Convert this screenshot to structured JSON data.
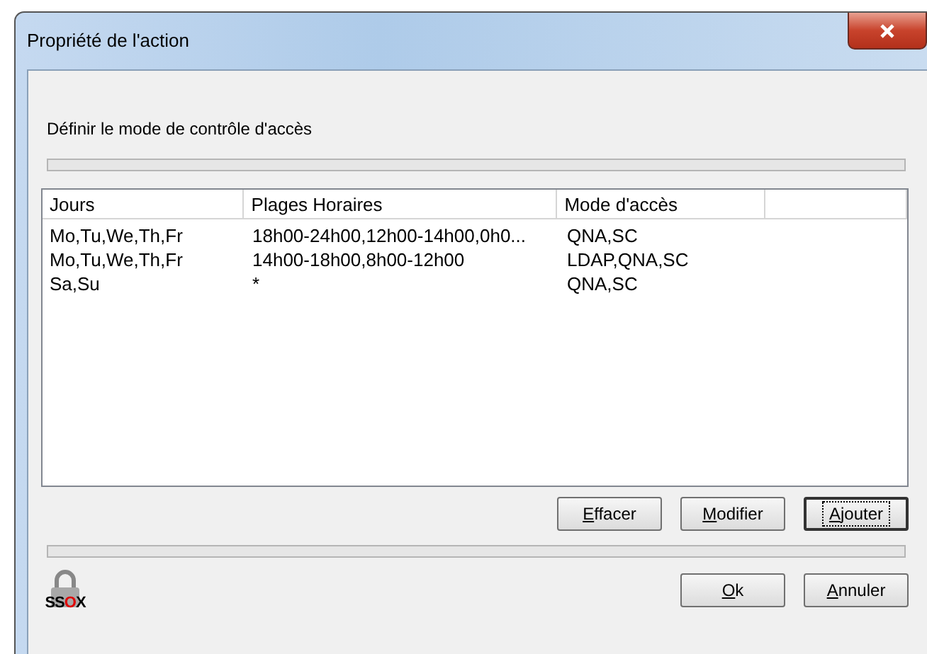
{
  "window": {
    "title": "Propriété de l'action"
  },
  "instruction": "Définir le mode de contrôle d'accès",
  "table": {
    "columns": [
      "Jours",
      "Plages Horaires",
      "Mode d'accès"
    ],
    "rows": [
      {
        "cells": [
          "Mo,Tu,We,Th,Fr",
          "18h00-24h00,12h00-14h00,0h0...",
          "QNA,SC"
        ]
      },
      {
        "cells": [
          "Mo,Tu,We,Th,Fr",
          "14h00-18h00,8h00-12h00",
          "LDAP,QNA,SC"
        ]
      },
      {
        "cells": [
          "Sa,Su",
          "*",
          "QNA,SC"
        ]
      }
    ]
  },
  "list_buttons": [
    {
      "key": "E",
      "rest": "ffacer",
      "focused": false
    },
    {
      "key": "M",
      "rest": "odifier",
      "focused": false
    },
    {
      "key": "A",
      "rest": "jouter",
      "focused": true
    }
  ],
  "logo": {
    "before": "SS",
    "highlight": "O",
    "after": "X"
  },
  "dialog_buttons": [
    {
      "key": "O",
      "rest": "k",
      "focused": false
    },
    {
      "key": "A",
      "rest": "nnuler",
      "focused": false
    }
  ]
}
